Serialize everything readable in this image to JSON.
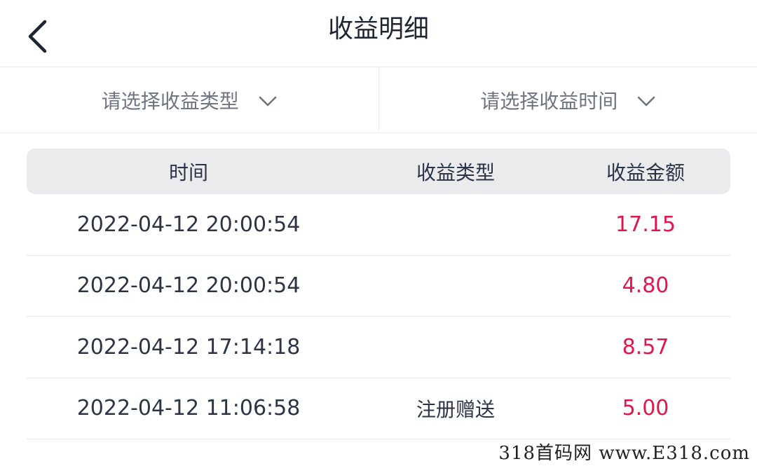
{
  "header": {
    "title": "收益明细",
    "back_icon": "chevron-left-icon"
  },
  "filters": {
    "type_placeholder": "请选择收益类型",
    "time_placeholder": "请选择收益时间",
    "dropdown_icon": "chevron-down-icon"
  },
  "table": {
    "columns": [
      "时间",
      "收益类型",
      "收益金额"
    ],
    "rows": [
      {
        "time": "2022-04-12 20:00:54",
        "type": "",
        "amount": "17.15"
      },
      {
        "time": "2022-04-12 20:00:54",
        "type": "",
        "amount": "4.80"
      },
      {
        "time": "2022-04-12 17:14:18",
        "type": "",
        "amount": "8.57"
      },
      {
        "time": "2022-04-12 11:06:58",
        "type": "注册赠送",
        "amount": "5.00"
      }
    ]
  },
  "watermark": "318首码网  www.E318.com",
  "colors": {
    "amount": "#e0174a",
    "header_bg": "#ebebed",
    "text": "#2b3346"
  }
}
